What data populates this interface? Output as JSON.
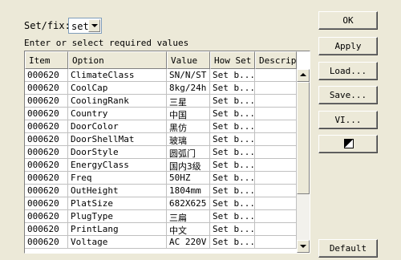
{
  "setfix": {
    "label": "Set/fix:",
    "value": "set"
  },
  "instruction": "Enter or select required values",
  "table": {
    "columns": [
      "Item",
      "Option",
      "Value",
      "How Set",
      "Descript"
    ],
    "rows": [
      [
        "000620",
        "ClimateClass",
        "SN/N/ST",
        "Set b...",
        ""
      ],
      [
        "000620",
        "CoolCap",
        "8kg/24h",
        "Set b...",
        ""
      ],
      [
        "000620",
        "CoolingRank",
        "三星",
        "Set b...",
        ""
      ],
      [
        "000620",
        "Country",
        "中国",
        "Set b...",
        ""
      ],
      [
        "000620",
        "DoorColor",
        "黑仿",
        "Set b...",
        ""
      ],
      [
        "000620",
        "DoorShellMat",
        "玻璃",
        "Set b...",
        ""
      ],
      [
        "000620",
        "DoorStyle",
        "圆弧门",
        "Set b...",
        ""
      ],
      [
        "000620",
        "EnergyClass",
        "国内3级",
        "Set b...",
        ""
      ],
      [
        "000620",
        "Freq",
        "50HZ",
        "Set b...",
        ""
      ],
      [
        "000620",
        "OutHeight",
        "1804mm",
        "Set b...",
        ""
      ],
      [
        "000620",
        "PlatSize",
        "682X625",
        "Set b...",
        ""
      ],
      [
        "000620",
        "PlugType",
        "三扁",
        "Set b...",
        ""
      ],
      [
        "000620",
        "PrintLang",
        "中文",
        "Set b...",
        ""
      ],
      [
        "000620",
        "Voltage",
        "AC 220V",
        "Set b...",
        ""
      ]
    ]
  },
  "buttons": {
    "ok": "OK",
    "apply": "Apply",
    "load": "Load...",
    "save": "Save...",
    "vi": "VI...",
    "default": "Default"
  }
}
